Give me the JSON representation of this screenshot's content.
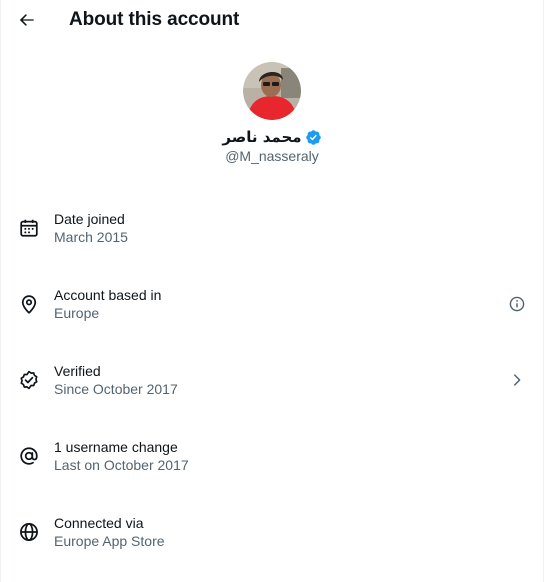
{
  "header": {
    "back_icon": "arrow-left-icon",
    "title": "About this account"
  },
  "profile": {
    "display_name": "محمد ناصر",
    "verified_icon": "verified-badge-icon",
    "handle": "@M_nasseraly",
    "avatar_shirt_color": "#e8262d",
    "verified_color": "#1d9bf0"
  },
  "rows": [
    {
      "icon": "calendar-icon",
      "title": "Date joined",
      "subtitle": "March 2015",
      "action": null
    },
    {
      "icon": "location-pin-icon",
      "title": "Account based in",
      "subtitle": "Europe",
      "action": "info-icon"
    },
    {
      "icon": "verified-check-icon",
      "title": "Verified",
      "subtitle": "Since October 2017",
      "action": "chevron-right-icon"
    },
    {
      "icon": "at-sign-icon",
      "title": "1 username change",
      "subtitle": "Last on October 2017",
      "action": null
    },
    {
      "icon": "globe-icon",
      "title": "Connected via",
      "subtitle": "Europe App Store",
      "action": null
    }
  ],
  "colors": {
    "text_primary": "#0f1419",
    "text_secondary": "#536471"
  }
}
